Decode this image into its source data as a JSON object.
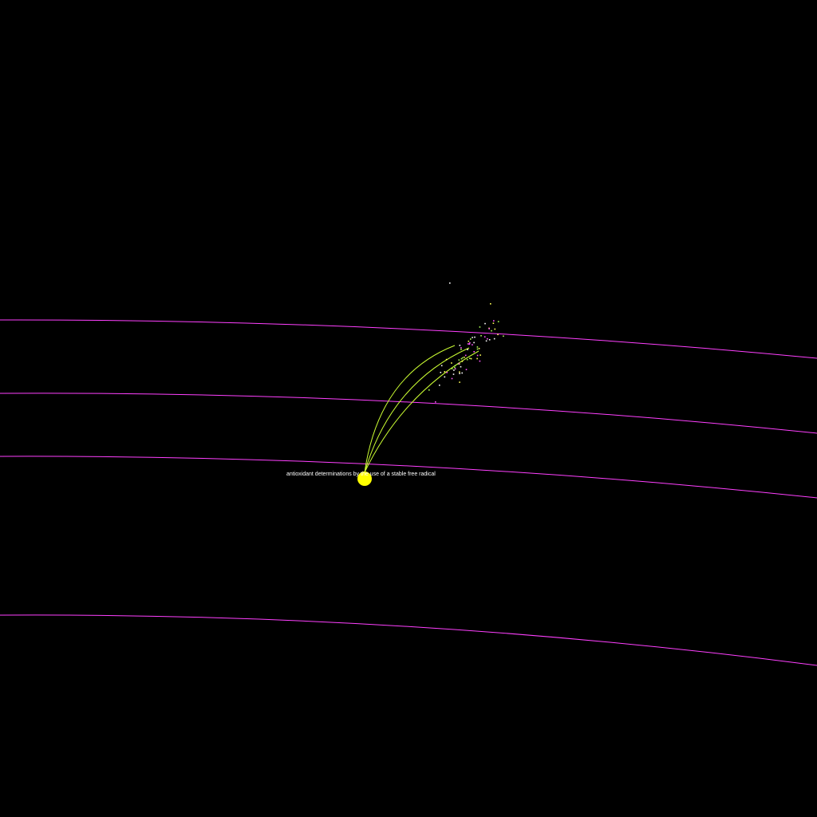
{
  "canvas": {
    "background_color": "#000000"
  },
  "node": {
    "label": "antioxidant determinations by the use of a stable free radical",
    "color": "#ffff00"
  },
  "orbit_lines": {
    "color": "#ff40ff",
    "count": 4
  },
  "citation_arcs": {
    "color": "#ccff33",
    "count": 3
  },
  "particles": {
    "colors": [
      "#ff55ff",
      "#aaff55",
      "#ffffff",
      "#ffff55"
    ]
  }
}
